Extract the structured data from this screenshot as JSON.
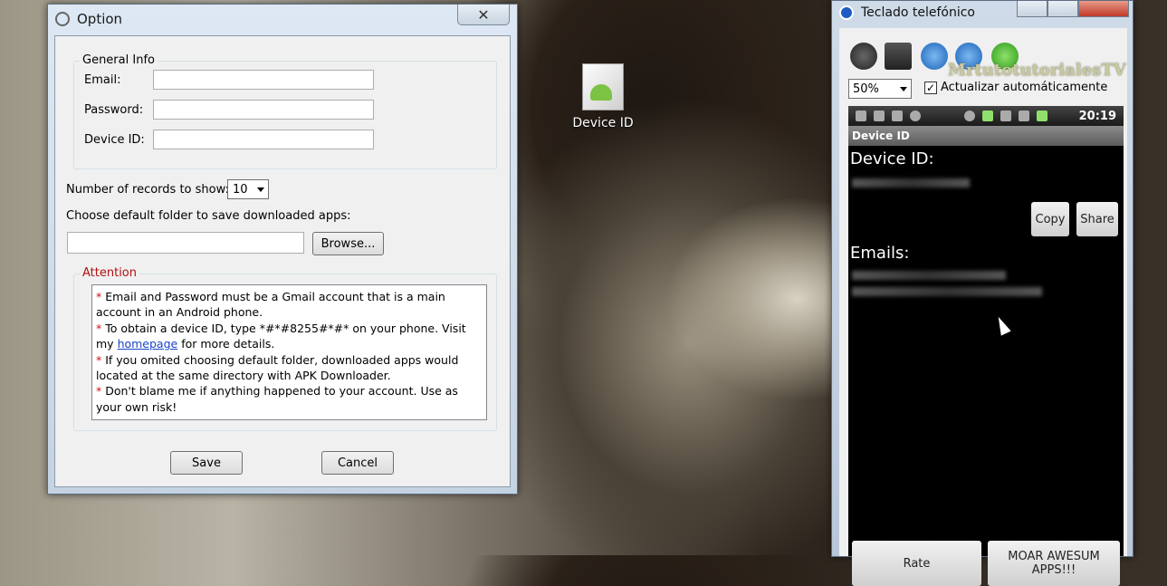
{
  "desktop": {
    "icon_label": "Device ID"
  },
  "option_window": {
    "title": "Option",
    "close_symbol": "✕",
    "general_info": {
      "legend": "General Info",
      "email_label": "Email:",
      "email_value": "",
      "password_label": "Password:",
      "password_value": "",
      "device_id_label": "Device ID:",
      "device_id_value": ""
    },
    "records_label": "Number of records  to show:",
    "records_value": "10",
    "folder_label": "Choose default folder to save downloaded apps:",
    "folder_value": "",
    "browse_label": "Browse...",
    "attention": {
      "legend": "Attention",
      "star": "*",
      "line1": " Email and Password must be a Gmail account that is a main account in an Android phone.",
      "line2a": " To obtain a device ID, type *#*#8255#*#* on your phone. Visit my ",
      "link": "homepage",
      "line2b": " for more details.",
      "line3": " If you omited choosing default folder, downloaded apps would located at the same directory with APK Downloader.",
      "line4": " Don't blame me if anything happened to your account. Use as your own risk!"
    },
    "save_label": "Save",
    "cancel_label": "Cancel"
  },
  "phone_window": {
    "title": "Teclado telefónico",
    "watermark": "MrtutotutorialesTV",
    "zoom": "50%",
    "auto_update_label": "Actualizar automáticamente",
    "auto_update_checked": "✓",
    "status_time": "20:19",
    "app_title": "Device ID",
    "device_id_label": "Device ID:",
    "copy_label": "Copy",
    "share_label": "Share",
    "emails_label": "Emails:",
    "rate_label": "Rate",
    "moar_label": "MOAR AWESUM APPS!!!"
  }
}
